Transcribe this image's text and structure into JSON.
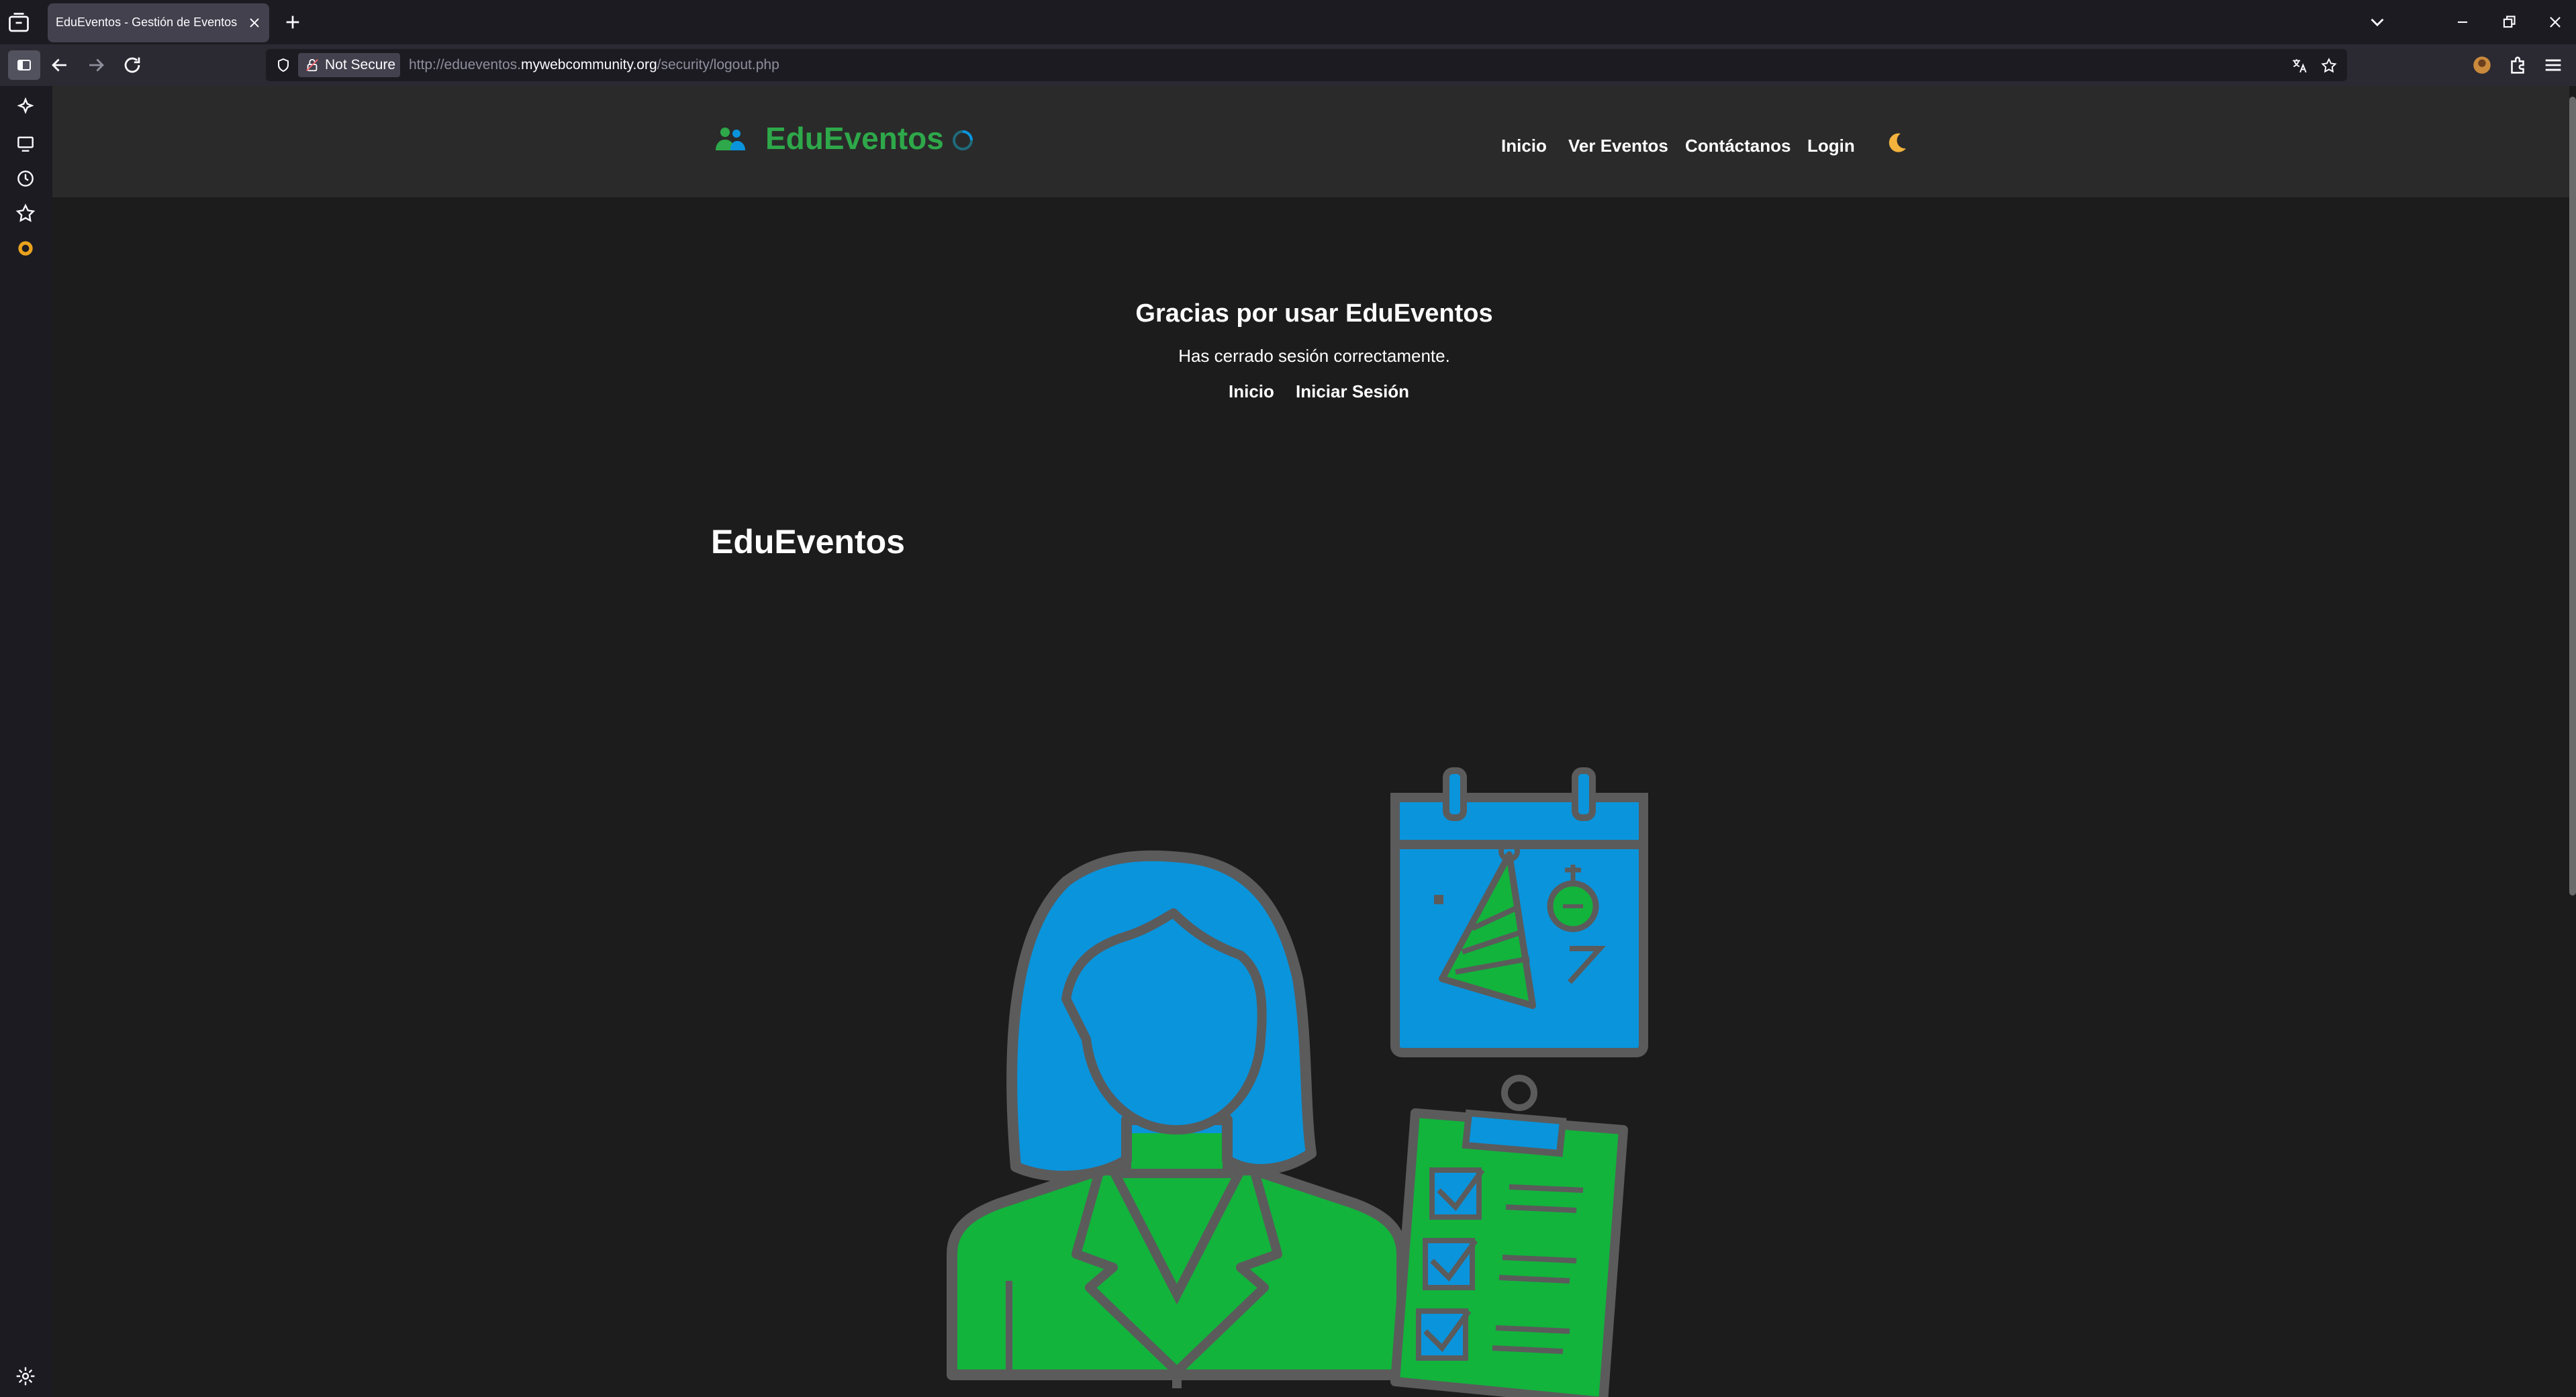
{
  "browser": {
    "tab_title": "EduEventos - Gestión de Eventos",
    "security_label": "Not Secure",
    "url_prefix": "http://edueventos.",
    "url_domain": "mywebcommunity.org",
    "url_path": "/security/logout.php"
  },
  "site": {
    "brand": "EduEventos",
    "nav": [
      "Inicio",
      "Ver Eventos",
      "Contáctanos",
      "Login"
    ],
    "theme_toggle_icon": "moon-icon",
    "brand_color": "#2ea84a",
    "accent_blue": "#0a94dc",
    "accent_green": "#12b43c"
  },
  "logout": {
    "title": "Gracias por usar EduEventos",
    "message": "Has cerrado sesión correctamente.",
    "links": [
      "Inicio",
      "Iniciar Sesión"
    ]
  },
  "section": {
    "title": "EduEventos"
  }
}
